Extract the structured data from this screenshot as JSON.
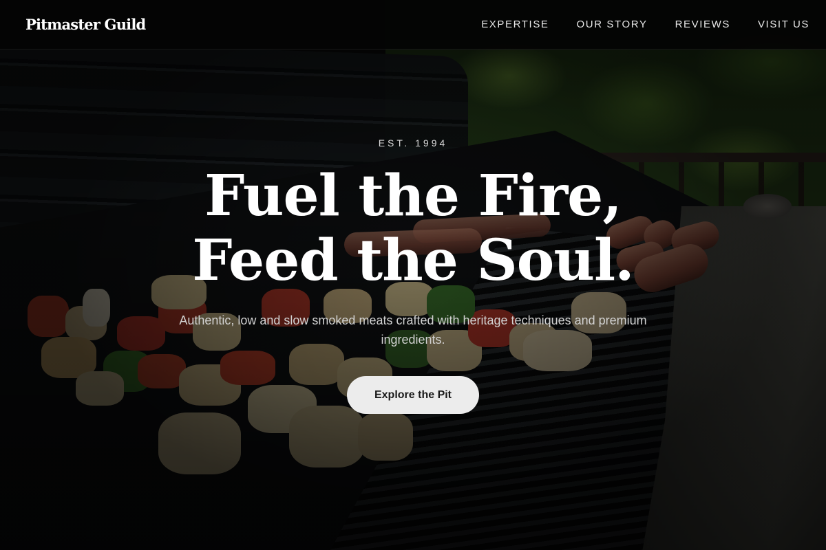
{
  "nav": {
    "brand": "Pitmaster Guild",
    "links": [
      "EXPERTISE",
      "OUR STORY",
      "REVIEWS",
      "VISIT US"
    ]
  },
  "hero": {
    "eyebrow": "EST. 1994",
    "headline_line1": "Fuel the Fire,",
    "headline_line2": "Feed the Soul.",
    "subhead": "Authentic, low and slow smoked meats crafted with heritage techniques and premium ingredients.",
    "cta_label": "Explore the Pit",
    "background": "grilled skewers and sausages on barbecue grill"
  },
  "colors": {
    "nav_bg": "#040404",
    "text_primary": "#ffffff",
    "cta_bg": "#ececec",
    "cta_text": "#1a1a1a"
  }
}
